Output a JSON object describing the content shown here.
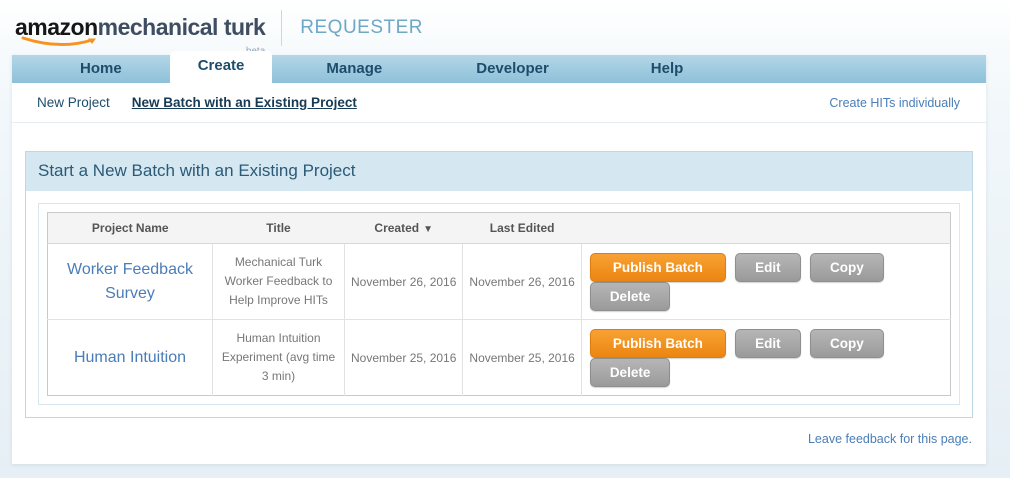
{
  "header": {
    "logo": {
      "amazon": "amazon",
      "mechanical_turk": "mechanical turk",
      "beta": "beta"
    },
    "requester_label": "REQUESTER"
  },
  "nav": {
    "tabs": [
      {
        "label": "Home",
        "active": false
      },
      {
        "label": "Create",
        "active": true
      },
      {
        "label": "Manage",
        "active": false
      },
      {
        "label": "Developer",
        "active": false
      },
      {
        "label": "Help",
        "active": false
      }
    ]
  },
  "subnav": {
    "items": [
      {
        "label": "New Project",
        "active": false
      },
      {
        "label": "New Batch with an Existing Project",
        "active": true
      }
    ],
    "right_link": "Create HITs individually"
  },
  "main": {
    "panel_title": "Start a New Batch with an Existing Project",
    "table": {
      "headers": [
        "Project Name",
        "Title",
        "Created",
        "Last Edited"
      ],
      "sort_column": "Created",
      "sort_indicator": "▼",
      "rows": [
        {
          "project_name": "Worker Feedback Survey",
          "title": "Mechanical Turk Worker Feedback to Help Improve HITs",
          "created": "November 26, 2016",
          "last_edited": "November 26, 2016",
          "actions": [
            "Publish Batch",
            "Edit",
            "Copy",
            "Delete"
          ]
        },
        {
          "project_name": "Human Intuition",
          "title": "Human Intuition Experiment (avg time 3 min)",
          "created": "November 25, 2016",
          "last_edited": "November 25, 2016",
          "actions": [
            "Publish Batch",
            "Edit",
            "Copy",
            "Delete"
          ]
        }
      ]
    }
  },
  "footer": {
    "feedback_link": "Leave feedback for this page."
  },
  "colors": {
    "tabbar_blue_top": "#b3d6e7",
    "tabbar_blue_bottom": "#8ec0d9",
    "panel_heading_bg": "#d5e8f2",
    "nav_text": "#1d4d6b",
    "link_blue": "#4a7db8",
    "publish_button_orange": "#ec8511",
    "secondary_button_gray": "#9a9a9a",
    "amazon_swoosh_orange": "#f79420",
    "requester_text": "#6fa7c7"
  }
}
